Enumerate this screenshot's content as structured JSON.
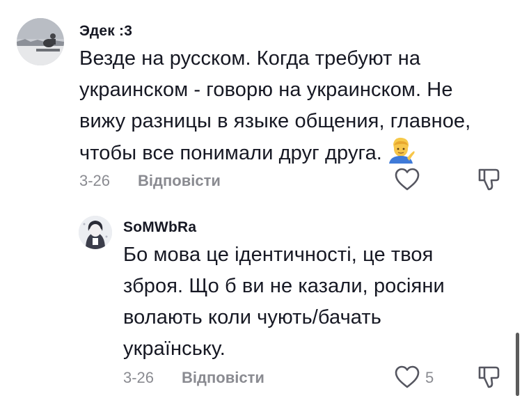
{
  "comments": [
    {
      "username": "Эдек :3",
      "lines": [
        "Везде на русском. Когда требуют на",
        "украинском - говорю на украинском. Не",
        "вижу разницы в языке общения, главное,",
        "чтобы все понимали друг друга."
      ],
      "emoji": "person-tipping-hand",
      "date": "3-26",
      "reply_label": "Відповісти",
      "like_count": ""
    },
    {
      "username": "SoMWbRa",
      "lines": [
        "Бо мова це ідентичності, це твоя",
        "зброя. Що б ви не казали, росіяни",
        "волають коли чують/бачать",
        "українську."
      ],
      "date": "3-26",
      "reply_label": "Відповісти",
      "like_count": "5"
    }
  ],
  "icons": {
    "like": "heart-outline-icon",
    "dislike": "thumbs-down-outline-icon"
  },
  "colors": {
    "text": "#161823",
    "secondary": "#8a8b91",
    "background": "#ffffff"
  }
}
